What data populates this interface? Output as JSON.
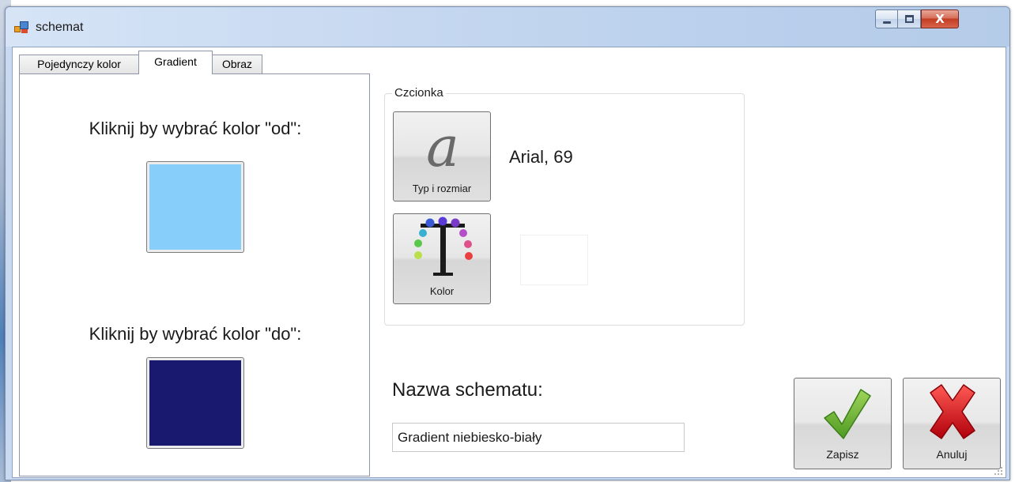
{
  "window": {
    "title": "schemat",
    "app_icon": "app-window-icon",
    "controls": {
      "minimize_icon": "minimize-icon",
      "maximize_icon": "maximize-icon",
      "close_icon": "close-icon",
      "close_glyph": "X"
    }
  },
  "tabs": [
    {
      "label": "Pojedynczy kolor",
      "selected": false
    },
    {
      "label": "Gradient",
      "selected": true
    },
    {
      "label": "Obraz",
      "selected": false
    }
  ],
  "gradient": {
    "from_label": "Kliknij by wybrać kolor \"od\":",
    "from_color": "#87cefa",
    "to_label": "Kliknij by wybrać kolor \"do\":",
    "to_color": "#191970"
  },
  "font_group": {
    "title": "Czcionka",
    "font_button": {
      "icon": "font-a-icon",
      "glyph": "a",
      "label": "Typ i rozmiar"
    },
    "font_value": "Arial, 69",
    "color_button": {
      "icon": "text-color-icon",
      "label": "Kolor"
    },
    "font_color": "#ffffff"
  },
  "scheme": {
    "name_label": "Nazwa schematu:",
    "name_value": "Gradient niebiesko-biały"
  },
  "actions": {
    "save": {
      "icon": "checkmark-icon",
      "label": "Zapisz",
      "color": "#6fae3a"
    },
    "cancel": {
      "icon": "cross-icon",
      "label": "Anuluj",
      "color": "#d3121c"
    }
  }
}
